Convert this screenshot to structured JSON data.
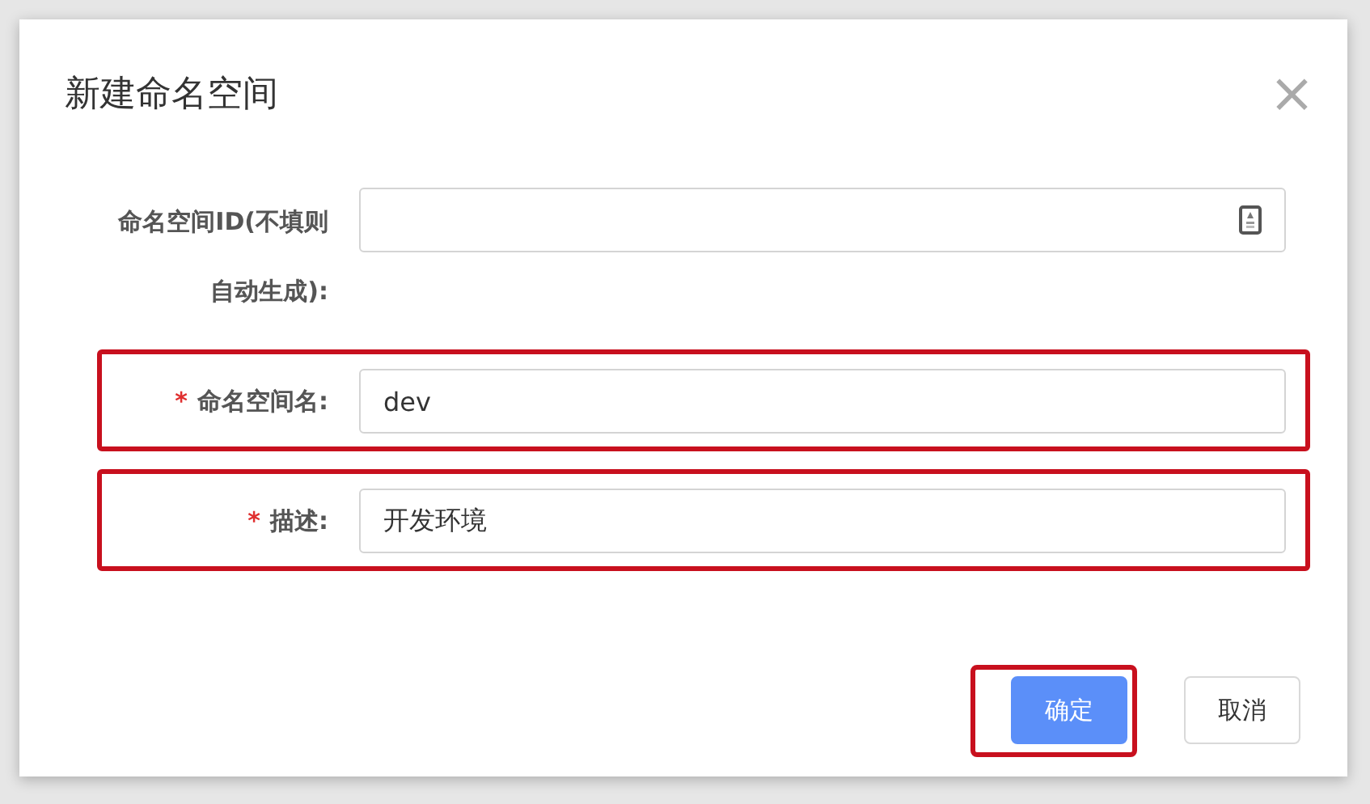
{
  "dialog": {
    "title": "新建命名空间",
    "close": "×"
  },
  "fields": [
    {
      "label": "命名空间ID(不填则自动生成):",
      "kind": "with-icon",
      "highlighted": false
    },
    {
      "label": "命名空间名:",
      "required_mark": "*",
      "kind": "text",
      "value": "dev",
      "highlighted": true
    },
    {
      "label": "描述:",
      "required_mark": "*",
      "kind": "text",
      "value": "开发环境",
      "highlighted": true
    }
  ],
  "buttons": [
    {
      "label": "确定",
      "kind": "primary",
      "highlighted": true
    },
    {
      "label": "取消",
      "kind": "default",
      "highlighted": false
    }
  ]
}
